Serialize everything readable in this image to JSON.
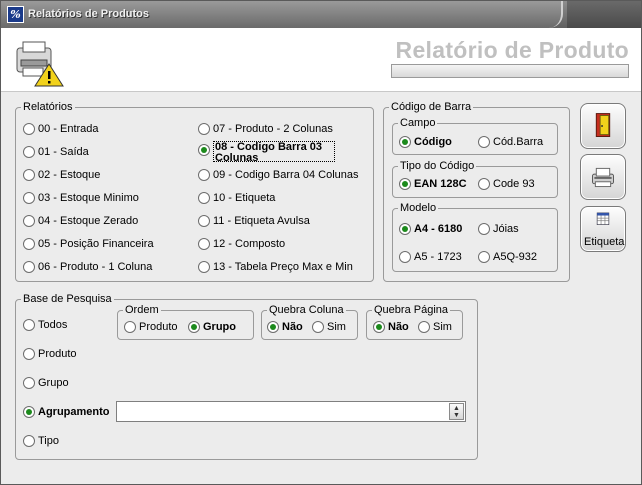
{
  "window": {
    "title": "Relatórios de Produtos",
    "app_icon": "app-icon"
  },
  "header": {
    "title": "Relatório de Produto",
    "icon": "printer-warning-icon"
  },
  "relatorios": {
    "label": "Relatórios",
    "left": [
      "00 - Entrada",
      "01 - Saída",
      "02 - Estoque",
      "03 - Estoque Minimo",
      "04 - Estoque Zerado",
      "05 - Posição Financeira",
      "06 - Produto - 1 Coluna"
    ],
    "right": [
      "07 - Produto - 2 Colunas",
      "08 - Codigo Barra 03 Colunas",
      "09 - Codigo Barra 04 Colunas",
      "10 - Etiqueta",
      "11 - Etiqueta Avulsa",
      "12 - Composto",
      "13 - Tabela Preço Max e Min"
    ],
    "selected": "08 - Codigo Barra 03 Colunas"
  },
  "codigo_barra": {
    "label": "Código de Barra",
    "campo": {
      "label": "Campo",
      "options": [
        "Código",
        "Cód.Barra"
      ],
      "selected": "Código"
    },
    "tipo": {
      "label": "Tipo do Código",
      "options": [
        "EAN 128C",
        "Code 93"
      ],
      "selected": "EAN 128C"
    },
    "modelo": {
      "label": "Modelo",
      "options": [
        "A4 - 6180",
        "Jóias",
        "A5 - 1723",
        "A5Q-932"
      ],
      "selected": "A4 - 6180"
    }
  },
  "base": {
    "label": "Base de Pesquisa",
    "options": [
      "Todos",
      "Produto",
      "Grupo",
      "Agrupamento",
      "Tipo"
    ],
    "selected": "Agrupamento",
    "combo_value": ""
  },
  "ordem": {
    "label": "Ordem",
    "options": [
      "Produto",
      "Grupo"
    ],
    "selected": "Grupo"
  },
  "quebra_coluna": {
    "label": "Quebra Coluna",
    "options": [
      "Não",
      "Sim"
    ],
    "selected": "Não"
  },
  "quebra_pagina": {
    "label": "Quebra Página",
    "options": [
      "Não",
      "Sim"
    ],
    "selected": "Não"
  },
  "side_buttons": {
    "exit_icon": "exit-door-icon",
    "print_icon": "printer-icon",
    "etiqueta_icon": "calendar-label-icon",
    "etiqueta_label": "Etiqueta"
  },
  "colors": {
    "checked": "#1c8a1c",
    "window_bg": "#ececec",
    "title_bar": "#6a6a6a"
  }
}
